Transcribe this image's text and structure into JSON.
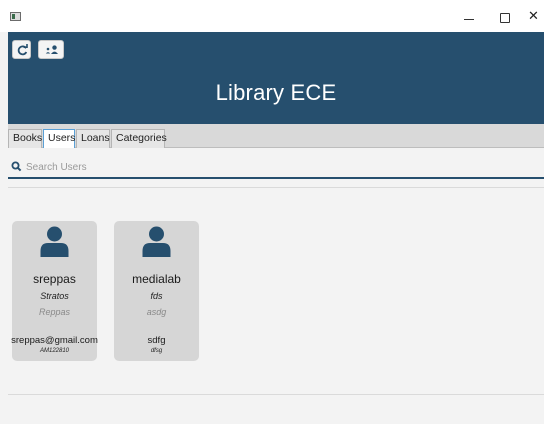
{
  "window": {
    "minimize_glyph": "",
    "close_glyph": "✕"
  },
  "toolbar": {
    "refresh_icon": "refresh-icon",
    "users_icon": "users-icon"
  },
  "header": {
    "title": "Library ECE",
    "background": "#264f6e"
  },
  "tabs": [
    {
      "label": "Books",
      "active": false
    },
    {
      "label": "Users",
      "active": true
    },
    {
      "label": "Loans",
      "active": false
    },
    {
      "label": "Categories",
      "active": false
    }
  ],
  "search": {
    "value": "",
    "placeholder": "Search Users"
  },
  "users": [
    {
      "username": "sreppas",
      "first_name": "Stratos",
      "last_name": "Reppas",
      "email": "sreppas@gmail.com",
      "am": "AM122810"
    },
    {
      "username": "medialab",
      "first_name": "fds",
      "last_name": "asdg",
      "email": "sdfg",
      "am": "dfsg"
    }
  ]
}
